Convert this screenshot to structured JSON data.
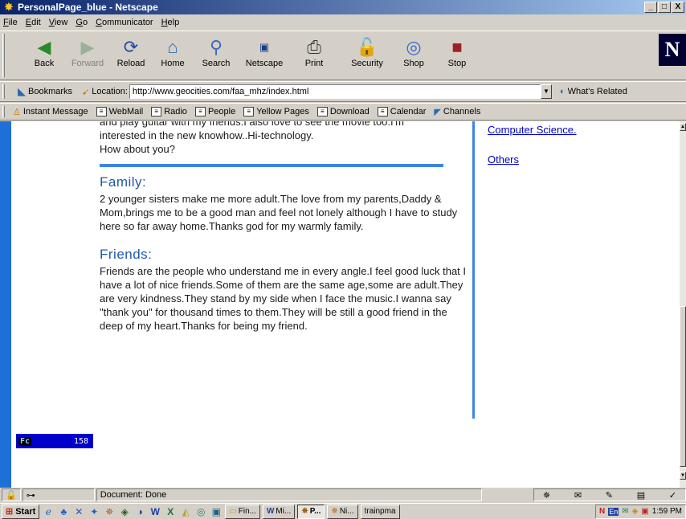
{
  "window": {
    "title": "PersonalPage_blue - Netscape",
    "controls": [
      "_",
      "□",
      "X"
    ]
  },
  "menu": [
    "File",
    "Edit",
    "View",
    "Go",
    "Communicator",
    "Help"
  ],
  "nav": {
    "back": "Back",
    "forward": "Forward",
    "reload": "Reload",
    "home": "Home",
    "search": "Search",
    "netscape": "Netscape",
    "print": "Print",
    "security": "Security",
    "shop": "Shop",
    "stop": "Stop",
    "logo": "N"
  },
  "location": {
    "bookmarks": "Bookmarks",
    "label": "Location:",
    "url": "http://www.geocities.com/faa_mhz/index.html",
    "related": "What's Related"
  },
  "personal_toolbar": [
    "Instant Message",
    "WebMail",
    "Radio",
    "People",
    "Yellow Pages",
    "Download",
    "Calendar",
    "Channels"
  ],
  "page": {
    "intro_lines": [
      "and play guitar with my friends.I also love to see the movie too.I'm",
      "interested in the new knowhow..Hi-technology.",
      "How about you?"
    ],
    "family_title": "Family:",
    "family_text": "2 younger sisters make me more adult.The love from my parents,Daddy & Mom,brings me to be a good man and feel not lonely although I have to study here so far away home.Thanks god for my warmly family.",
    "friends_title": "Friends:",
    "friends_text": "Friends are the people who understand me in every angle.I feel good luck that I have a lot of nice friends.Some of them are the same age,some are adult.They are very kindness.They stand by my side when I face the music.I wanna say \"thank you\" for thousand times to them.They will be still a good friend in the deep of my heart.Thanks for being my friend.",
    "side_links": [
      "Computer Science.",
      "Others"
    ],
    "counter_label": "Fc",
    "counter_value": "158"
  },
  "status": {
    "text": "Document: Done"
  },
  "taskbar": {
    "start": "Start",
    "tasks": [
      "Fin...",
      "Mi...",
      "P...",
      "Ni...",
      "trainpma"
    ],
    "clock": "1:59 PM"
  }
}
